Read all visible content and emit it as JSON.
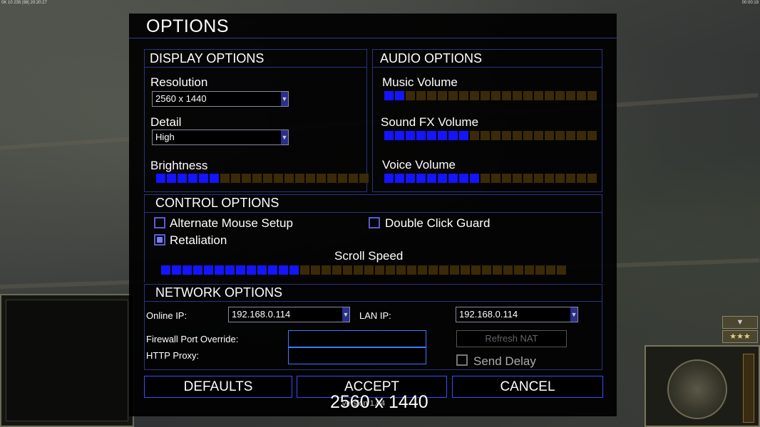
{
  "hud": {
    "top_left": "0K 10 235 |98| 20:20:27",
    "top_right": "00:00:19",
    "rank_stars": "★★★",
    "rank_arrow": "▼"
  },
  "dialog": {
    "title": "OPTIONS",
    "display": {
      "title": "DISPLAY OPTIONS",
      "resolution_label": "Resolution",
      "resolution_value": "2560 x 1440",
      "detail_label": "Detail",
      "detail_value": "High",
      "brightness_label": "Brightness",
      "brightness_level": 6,
      "brightness_total": 20
    },
    "audio": {
      "title": "AUDIO OPTIONS",
      "music_label": "Music Volume",
      "music_level": 2,
      "sfx_label": "Sound FX Volume",
      "sfx_level": 8,
      "voice_label": "Voice Volume",
      "voice_level": 9,
      "total": 20
    },
    "control": {
      "title": "CONTROL OPTIONS",
      "alt_mouse_label": "Alternate Mouse Setup",
      "alt_mouse_checked": false,
      "double_click_label": "Double Click Guard",
      "double_click_checked": false,
      "retaliation_label": "Retaliation",
      "retaliation_checked": true,
      "scroll_label": "Scroll Speed",
      "scroll_level": 13,
      "scroll_total": 38
    },
    "network": {
      "title": "NETWORK OPTIONS",
      "online_ip_label": "Online IP:",
      "online_ip_value": "192.168.0.114",
      "lan_ip_label": "LAN IP:",
      "lan_ip_value": "192.168.0.114",
      "firewall_label": "Firewall Port Override:",
      "firewall_value": "",
      "proxy_label": "HTTP Proxy:",
      "proxy_value": "",
      "refresh_nat_label": "Refresh NAT",
      "send_delay_label": "Send Delay",
      "send_delay_checked": false
    },
    "buttons": {
      "defaults": "DEFAULTS",
      "accept": "ACCEPT",
      "cancel": "CANCEL"
    },
    "version_text": "Version 1.04",
    "overlay_resolution": "2560 x 1440"
  },
  "colors": {
    "slider_on": "#1414ff",
    "slider_off": "#3b2a08",
    "border": "#2a3480",
    "button_border": "#3a4cff"
  }
}
